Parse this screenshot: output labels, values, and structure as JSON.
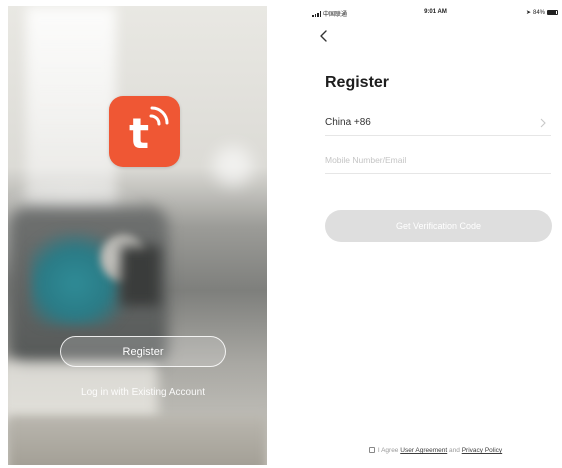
{
  "welcome": {
    "register_label": "Register",
    "login_label": "Log in with Existing Account",
    "logo_letter": "t",
    "logo_color": "#ef5734"
  },
  "register_screen": {
    "status_bar": {
      "carrier": "中国联通",
      "time": "9:01 AM",
      "battery": "84%"
    },
    "title": "Register",
    "country_value": "China +86",
    "account_placeholder": "Mobile Number/Email",
    "verify_button_label": "Get Verification Code",
    "agreement": {
      "prefix": "I Agree",
      "user_agreement": "User Agreement",
      "joiner": "and",
      "privacy_policy": "Privacy Policy"
    }
  },
  "icons": [
    "app-logo-icon",
    "wifi-icon",
    "back-chevron-icon",
    "chevron-right-icon",
    "checkbox-icon",
    "signal-icon",
    "battery-icon",
    "location-icon"
  ]
}
